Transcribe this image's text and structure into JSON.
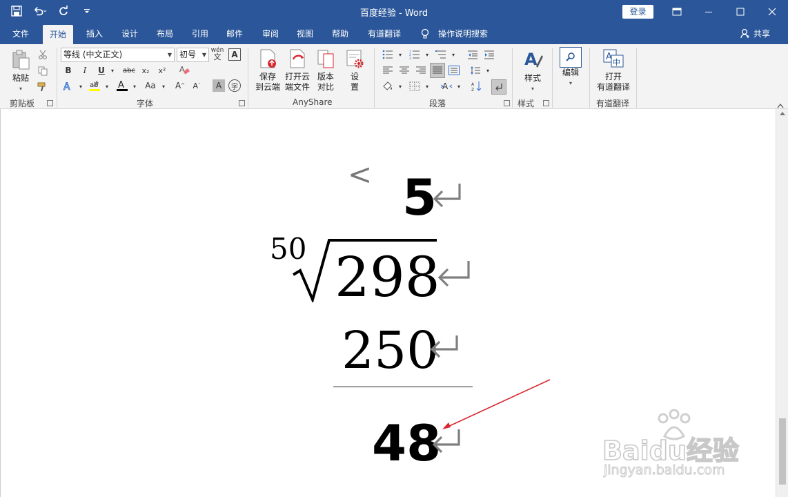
{
  "window": {
    "title": "百度经验  -  Word",
    "login": "登录"
  },
  "tabs": [
    "文件",
    "开始",
    "插入",
    "设计",
    "布局",
    "引用",
    "邮件",
    "审阅",
    "视图",
    "帮助",
    "有道翻译",
    "操作说明搜索"
  ],
  "share": "共享",
  "ribbon": {
    "clipboard": {
      "paste": "粘贴",
      "label": "剪贴板"
    },
    "font": {
      "name": "等线 (中文正文)",
      "size": "初号",
      "label": "字体",
      "phonetic_top": "wén",
      "phonetic_bottom": "文",
      "char_border": "A",
      "bold": "B",
      "italic": "I",
      "underline": "U",
      "strike": "abc",
      "sub": "x₂",
      "sup": "x²",
      "grow": "A",
      "shrink": "A",
      "case": "Aa",
      "shade": "A",
      "enclose": "字"
    },
    "anyshare": {
      "save_cloud": [
        "保存",
        "到云端"
      ],
      "open_cloud": [
        "打开云",
        "端文件"
      ],
      "compare": [
        "版本",
        "对比"
      ],
      "settings": [
        "设",
        "置"
      ],
      "label": "AnyShare"
    },
    "paragraph": {
      "label": "段落"
    },
    "styles": {
      "button": "样式",
      "label": "样式"
    },
    "editing": {
      "button": "编辑"
    },
    "youdao": {
      "button": [
        "打开",
        "有道翻译"
      ],
      "label": "有道翻译"
    }
  },
  "document": {
    "lines": [
      {
        "value": "5"
      },
      {
        "index": "50",
        "radicand": "298"
      },
      {
        "value": "250"
      },
      {
        "value": "48"
      }
    ],
    "paragraph_mark": "↵",
    "arrow_glyph": "<"
  },
  "watermark": {
    "brand": "Baidu经验",
    "url": "jingyan.baidu.com"
  },
  "colors": {
    "titlebar": "#2b579a",
    "ribbon": "#f3f3f3",
    "annotation_arrow": "#d9262c"
  }
}
